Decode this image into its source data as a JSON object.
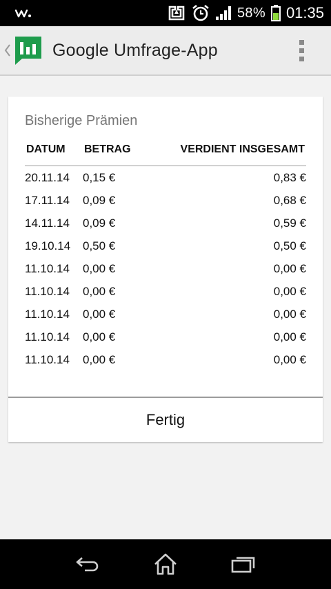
{
  "status_bar": {
    "icons": [
      "walkman-icon",
      "nfc-icon",
      "alarm-clock-icon",
      "signal-icon",
      "battery-icon"
    ],
    "battery_percent": "58%",
    "battery_level": 0.58,
    "clock": "01:35"
  },
  "action_bar": {
    "title": "Google Umfrage-App",
    "logo_icon": "google-opinion-rewards-logo",
    "logo_color": "#1e9c4c",
    "overflow_icon": "overflow-menu-icon"
  },
  "card": {
    "title": "Bisherige Prämien",
    "columns": {
      "date": "DATUM",
      "amount": "BETRAG",
      "total": "VERDIENT INSGESAMT"
    },
    "rows": [
      {
        "date": "20.11.14",
        "amount": "0,15 €",
        "total": "0,83 €"
      },
      {
        "date": "17.11.14",
        "amount": "0,09 €",
        "total": "0,68 €"
      },
      {
        "date": "14.11.14",
        "amount": "0,09 €",
        "total": "0,59 €"
      },
      {
        "date": "19.10.14",
        "amount": "0,50 €",
        "total": "0,50 €"
      },
      {
        "date": "11.10.14",
        "amount": "0,00 €",
        "total": "0,00 €"
      },
      {
        "date": "11.10.14",
        "amount": "0,00 €",
        "total": "0,00 €"
      },
      {
        "date": "11.10.14",
        "amount": "0,00 €",
        "total": "0,00 €"
      },
      {
        "date": "11.10.14",
        "amount": "0,00 €",
        "total": "0,00 €"
      },
      {
        "date": "11.10.14",
        "amount": "0,00 €",
        "total": "0,00 €"
      }
    ],
    "done_label": "Fertig"
  },
  "nav_bar": {
    "icons": [
      "back-icon",
      "home-icon",
      "recent-apps-icon"
    ]
  }
}
